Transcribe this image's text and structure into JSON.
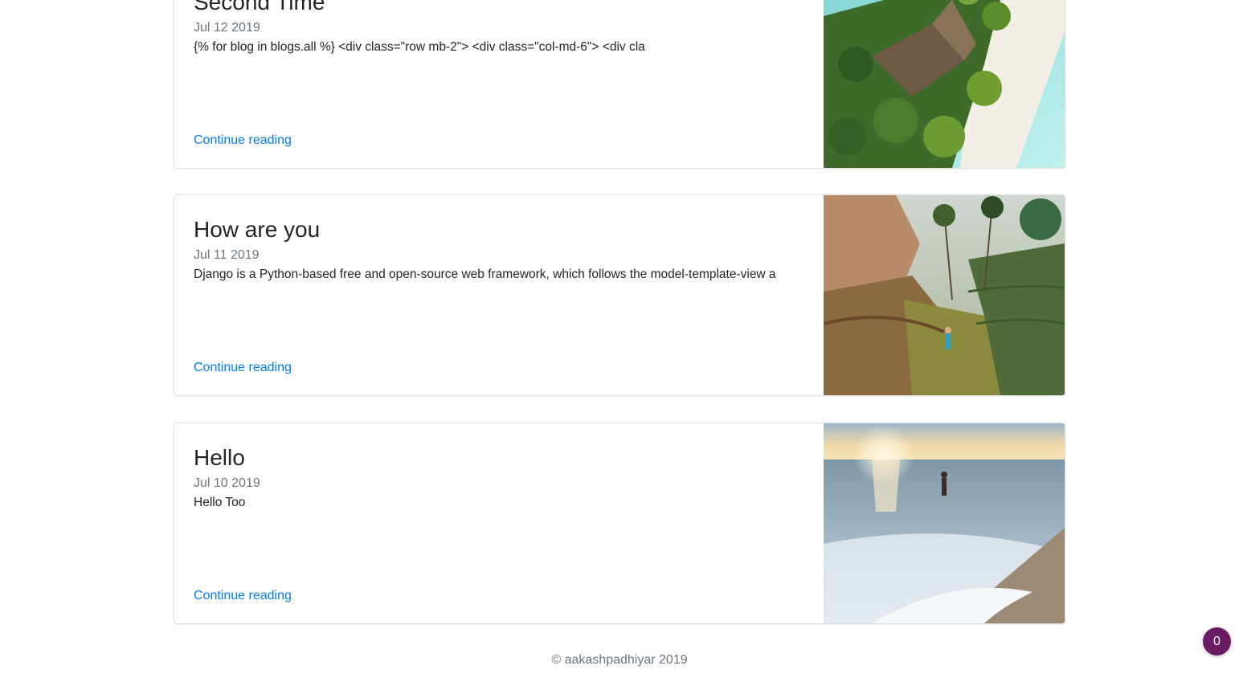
{
  "posts": [
    {
      "title": "Second Time",
      "date": "Jul 12 2019",
      "excerpt": "{% for blog in blogs.all %} <div class=\"row mb-2\"> <div class=\"col-md-6\"> <div cla",
      "link_label": "Continue reading",
      "image": "tropical-beach-resort-aerial-photo"
    },
    {
      "title": "How are you",
      "date": "Jul 11 2019",
      "excerpt": "Django is a Python-based free and open-source web framework, which follows the model-template-view a",
      "link_label": "Continue reading",
      "image": "rice-terraces-jungle-photo"
    },
    {
      "title": "Hello",
      "date": "Jul 10 2019",
      "excerpt": "Hello Too",
      "link_label": "Continue reading",
      "image": "sunset-ocean-shore-photo"
    }
  ],
  "footer": {
    "copyright": "© aakashpadhiyar 2019"
  },
  "badge": {
    "count": "0",
    "color": "#6a1b63"
  },
  "colors": {
    "link": "#007bff",
    "muted": "#6c757d",
    "text": "#212529"
  }
}
